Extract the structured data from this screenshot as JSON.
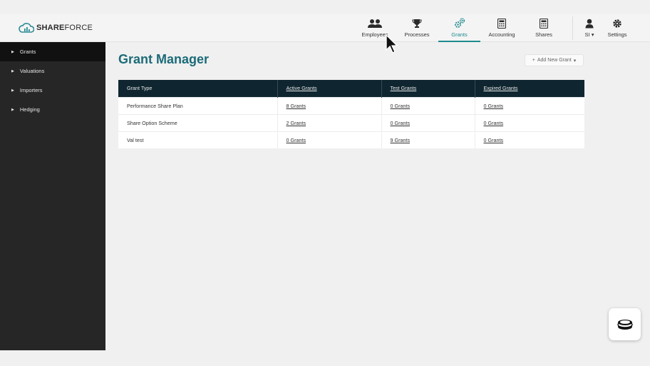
{
  "brand": {
    "logo_bold": "SHARE",
    "logo_light": "FORCE"
  },
  "nav": {
    "employees": "Employees",
    "processes": "Processes",
    "grants": "Grants",
    "accounting": "Accounting",
    "shares": "Shares",
    "user": "SI",
    "settings": "Settings"
  },
  "sidebar": {
    "items": [
      {
        "label": "Grants"
      },
      {
        "label": "Valuations"
      },
      {
        "label": "Importers"
      },
      {
        "label": "Hedging"
      }
    ]
  },
  "main": {
    "title": "Grant Manager",
    "add_button": "Add New Grant",
    "table": {
      "headers": [
        "Grant Type",
        "Active Grants",
        "Test Grants",
        "Expired Grants"
      ],
      "rows": [
        {
          "type": "Performance Share Plan",
          "active": "8 Grants",
          "test": "0 Grants",
          "expired": "0 Grants"
        },
        {
          "type": "Share Option Scheme",
          "active": "2 Grants",
          "test": "0 Grants",
          "expired": "0 Grants"
        },
        {
          "type": "Val test",
          "active": "0 Grants",
          "test": "9 Grants",
          "expired": "0 Grants"
        }
      ]
    }
  },
  "colors": {
    "accent": "#1e8a8f",
    "title": "#1c6b78",
    "table_header": "#0f2630",
    "sidebar": "#262626"
  }
}
